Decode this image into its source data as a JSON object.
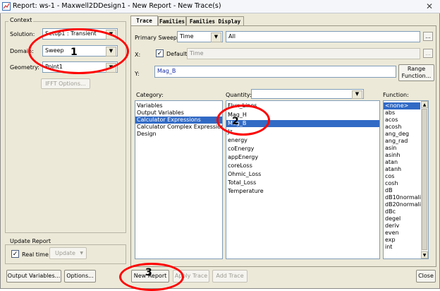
{
  "window": {
    "title": "Report: ws-1 - Maxwell2DDesign1 - New Report - New Trace(s)",
    "close_glyph": "✕"
  },
  "context": {
    "group_label": "Context",
    "solution_label": "Solution:",
    "solution_value": "Setup1 : Transient",
    "domain_label": "Domain:",
    "domain_value": "Sweep",
    "geometry_label": "Geometry:",
    "geometry_value": "Point1",
    "ifft_button": "IFFT Options..."
  },
  "update": {
    "group_label": "Update Report",
    "realtime_label": "Real time",
    "update_button": "Update"
  },
  "tabs": [
    "Trace",
    "Families",
    "Families Display"
  ],
  "trace": {
    "primary_sweep_label": "Primary Sweep:",
    "primary_sweep_value": "Time",
    "all_value": "All",
    "x_label": "X:",
    "default_label": "Default",
    "x_value": "Time",
    "y_label": "Y:",
    "y_value": "Mag_B",
    "range_function_line1": "Range",
    "range_function_line2": "Function..."
  },
  "category": {
    "label": "Category:",
    "items": [
      "Variables",
      "Output Variables",
      "Calculator Expressions",
      "Calculator Complex Expressions",
      "Design"
    ],
    "selected_index": 2
  },
  "quantity": {
    "label": "Quantity:",
    "items": [
      "Flux_Lines",
      "Mag_H",
      "Mag_B",
      "Jz",
      "energy",
      "coEnergy",
      "appEnergy",
      "coreLoss",
      "Ohmic_Loss",
      "Total_Loss",
      "Temperature"
    ],
    "selected_index": 2
  },
  "function": {
    "label": "Function:",
    "items": [
      "<none>",
      "abs",
      "acos",
      "acosh",
      "ang_deg",
      "ang_rad",
      "asin",
      "asinh",
      "atan",
      "atanh",
      "cos",
      "cosh",
      "dB",
      "dB10normalize",
      "dB20normalize",
      "dBc",
      "degel",
      "deriv",
      "even",
      "exp",
      "int"
    ],
    "selected_index": 0
  },
  "bottom": {
    "output_variables_button": "Output Variables...",
    "options_button": "Options...",
    "new_report_button": "New Report",
    "apply_trace_button": "Apply Trace",
    "add_trace_button": "Add Trace",
    "close_button": "Close"
  },
  "annotations": {
    "marker1": "1",
    "marker2": "2",
    "marker3": "3",
    "color": "#ff0000"
  },
  "colors": {
    "selection": "#316ac5",
    "dialog_bg": "#ece9d8"
  }
}
